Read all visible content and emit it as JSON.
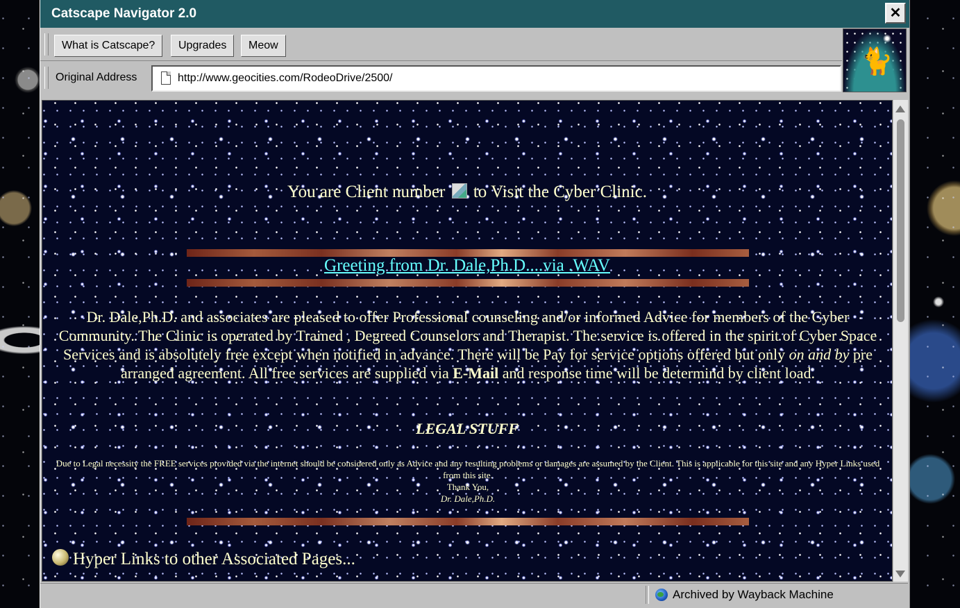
{
  "window": {
    "title": "Catscape Navigator 2.0",
    "close_label": "✕"
  },
  "toolbar": {
    "buttons": [
      "What is Catscape?",
      "Upgrades",
      "Meow"
    ]
  },
  "address": {
    "label": "Original Address",
    "url": "http://www.geocities.com/RodeoDrive/2500/"
  },
  "page": {
    "client_prefix": "You are Client number",
    "client_suffix": "to Visit the Cyber Clinic.",
    "greeting_link": "Greeting from Dr. Dale,Ph.D....via .WAV",
    "intro_part1": "Dr. Dale,Ph.D. and associates are pleased to offer Professional counseling and/or informed Advice for members of the Cyber Community. The Clinic is operated by Trained , Degreed Counselors and Therapist. The service is offered in the spirit of Cyber Space Services and is absolutely free except when notified in advance. There will be Pay for service options offered but only",
    "intro_italic": "on and by",
    "intro_part2": "pre arranged agreement. All free services are supplied via",
    "intro_bold": "E-Mail",
    "intro_part3": "and response time will be determind by client load.",
    "legal_heading": "LEGAL STUFF",
    "legal_text": "Due to Legal necessity the FREE services provided via the internet should be considered only as Advice and any resulting problems or damages are assumed by the Client. This is applicable for this site and any Hyper Links used from this site.",
    "legal_thanks": "Thank You,",
    "legal_signature": "Dr. Dale,Ph.D.",
    "links_heading": "Hyper Links to other Associated Pages..."
  },
  "status": {
    "text": "Archived by Wayback Machine"
  },
  "colors": {
    "titlebar": "#205a63",
    "text": "#ffffcc",
    "link": "#66ffff"
  },
  "icons": [
    "close-icon",
    "page-icon",
    "cat-logo-icon",
    "globe-icon",
    "orb-bullet-icon",
    "scroll-up-arrow-icon",
    "scroll-down-arrow-icon"
  ]
}
